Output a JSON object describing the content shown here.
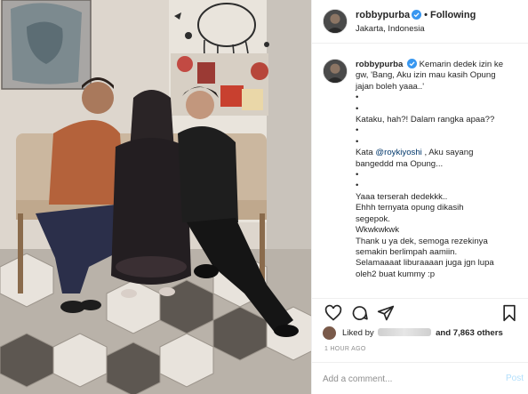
{
  "post": {
    "username": "robbypurba",
    "follow_state": "Following",
    "separator": "•",
    "location": "Jakarta, Indonesia"
  },
  "caption": {
    "username": "robbypurba",
    "lines": [
      "Kemarin dedek izin ke",
      "gw, 'Bang, Aku izin mau kasih Opung",
      "jajan boleh yaaa..'",
      "•",
      "•",
      "Kataku, hah?! Dalam rangka apaa??",
      "•",
      "•",
      "Kata @roykiyoshi , Aku sayang",
      "bangeddd ma Opung...",
      "•",
      "•",
      "Yaaa terserah dedekkk..",
      "Ehhh ternyata opung dikasih",
      "segepok.",
      "Wkwkwkwk",
      "Thank u ya dek, semoga rezekinya",
      "semakin berlimpah aamiin.",
      "Selamaaaat liburaaaan juga jgn lupa",
      "oleh2 buat kummy :p"
    ],
    "mention": "@roykiyoshi"
  },
  "likes": {
    "prefix": "Liked by",
    "suffix": "and 7,863 others"
  },
  "timestamp": "1 HOUR AGO",
  "comment_box": {
    "placeholder": "Add a comment...",
    "post_label": "Post"
  },
  "colors": {
    "verified": "#3897f0",
    "link": "#00376b",
    "post_disabled": "#b2dffc"
  },
  "icons": [
    "heart-icon",
    "comment-icon",
    "share-icon",
    "bookmark-icon",
    "verified-badge-icon"
  ]
}
